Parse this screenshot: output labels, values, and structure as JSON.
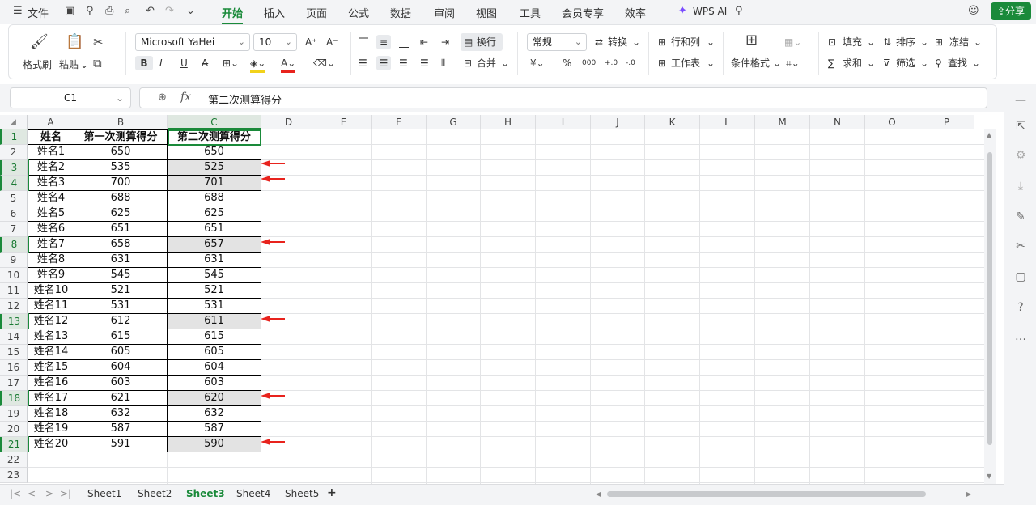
{
  "menubar": {
    "file_label": "文件",
    "tabs": [
      "开始",
      "插入",
      "页面",
      "公式",
      "数据",
      "审阅",
      "视图",
      "工具",
      "会员专享",
      "效率"
    ],
    "active_tab": "开始",
    "ai_label": "WPS AI",
    "share_label": "分享"
  },
  "ribbon": {
    "format_brush": "格式刷",
    "paste": "粘贴",
    "font_name": "Microsoft YaHei",
    "font_size": "10",
    "wrap": "换行",
    "merge": "合并",
    "number_format": "常规",
    "convert": "转换",
    "row_col": "行和列",
    "worksheet": "工作表",
    "cond_format": "条件格式",
    "fill": "填充",
    "sort": "排序",
    "freeze": "冻结",
    "sum": "求和",
    "filter": "筛选",
    "find": "查找"
  },
  "formula_bar": {
    "cell_ref": "C1",
    "formula": "第二次测算得分"
  },
  "columns": [
    "A",
    "B",
    "C",
    "D",
    "E",
    "F",
    "G",
    "H",
    "I",
    "J",
    "K",
    "L",
    "M",
    "N",
    "O",
    "P"
  ],
  "rows": [
    "1",
    "2",
    "3",
    "4",
    "5",
    "6",
    "7",
    "8",
    "9",
    "10",
    "11",
    "12",
    "13",
    "14",
    "15",
    "16",
    "17",
    "18",
    "19",
    "20",
    "21",
    "22",
    "23"
  ],
  "headers": [
    "姓名",
    "第一次测算得分",
    "第二次测算得分"
  ],
  "table": [
    {
      "name": "姓名1",
      "first": "650",
      "second": "650",
      "diff": false
    },
    {
      "name": "姓名2",
      "first": "535",
      "second": "525",
      "diff": true
    },
    {
      "name": "姓名3",
      "first": "700",
      "second": "701",
      "diff": true
    },
    {
      "name": "姓名4",
      "first": "688",
      "second": "688",
      "diff": false
    },
    {
      "name": "姓名5",
      "first": "625",
      "second": "625",
      "diff": false
    },
    {
      "name": "姓名6",
      "first": "651",
      "second": "651",
      "diff": false
    },
    {
      "name": "姓名7",
      "first": "658",
      "second": "657",
      "diff": true
    },
    {
      "name": "姓名8",
      "first": "631",
      "second": "631",
      "diff": false
    },
    {
      "name": "姓名9",
      "first": "545",
      "second": "545",
      "diff": false
    },
    {
      "name": "姓名10",
      "first": "521",
      "second": "521",
      "diff": false
    },
    {
      "name": "姓名11",
      "first": "531",
      "second": "531",
      "diff": false
    },
    {
      "name": "姓名12",
      "first": "612",
      "second": "611",
      "diff": true
    },
    {
      "name": "姓名13",
      "first": "615",
      "second": "615",
      "diff": false
    },
    {
      "name": "姓名14",
      "first": "605",
      "second": "605",
      "diff": false
    },
    {
      "name": "姓名15",
      "first": "604",
      "second": "604",
      "diff": false
    },
    {
      "name": "姓名16",
      "first": "603",
      "second": "603",
      "diff": false
    },
    {
      "name": "姓名17",
      "first": "621",
      "second": "620",
      "diff": true
    },
    {
      "name": "姓名18",
      "first": "632",
      "second": "632",
      "diff": false
    },
    {
      "name": "姓名19",
      "first": "587",
      "second": "587",
      "diff": false
    },
    {
      "name": "姓名20",
      "first": "591",
      "second": "590",
      "diff": true
    }
  ],
  "sheets": [
    "Sheet1",
    "Sheet2",
    "Sheet3",
    "Sheet4",
    "Sheet5"
  ],
  "active_sheet": "Sheet3",
  "colors": {
    "accent": "#1a8a3a",
    "arrow": "#e8231d",
    "diff_fill": "#e3e3e3"
  }
}
